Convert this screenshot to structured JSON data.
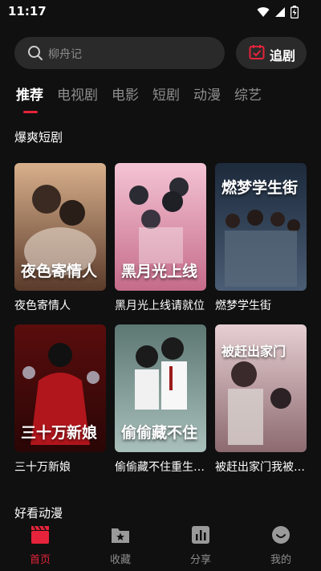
{
  "status_bar": {
    "time": "11:17"
  },
  "search": {
    "placeholder": "柳舟记"
  },
  "header": {
    "follow_label": "追剧"
  },
  "tabs": [
    "推荐",
    "电视剧",
    "电影",
    "短剧",
    "动漫",
    "综艺"
  ],
  "sections": {
    "hot_shorts": {
      "title": "爆爽短剧",
      "items": [
        {
          "title": "夜色寄情人",
          "poster_text": "夜色寄情人",
          "color": "#b57a5a"
        },
        {
          "title": "黑月光上线请就位",
          "poster_text": "黑月光上线",
          "color": "#d9a2b5"
        },
        {
          "title": "燃梦学生街",
          "poster_text": "燃梦学生街",
          "color": "#3b5d86"
        },
        {
          "title": "三十万新娘",
          "poster_text": "三十万新娘",
          "color": "#8c1e1e"
        },
        {
          "title": "偷偷藏不住重生之…",
          "poster_text": "偷偷藏不住",
          "color": "#6f8f8a"
        },
        {
          "title": "被赶出家门我被…",
          "poster_text": "被赶出家门",
          "color": "#d6b4b8"
        }
      ]
    },
    "anime": {
      "title": "好看动漫"
    }
  },
  "bottom_nav": [
    {
      "label": "首页",
      "icon": "clapperboard-icon",
      "active": true
    },
    {
      "label": "收藏",
      "icon": "favorites-folder-icon",
      "active": false
    },
    {
      "label": "分享",
      "icon": "bar-chart-icon",
      "active": false
    },
    {
      "label": "我的",
      "icon": "user-smile-icon",
      "active": false
    }
  ],
  "colors": {
    "accent": "#e5233a",
    "background": "#101010"
  }
}
